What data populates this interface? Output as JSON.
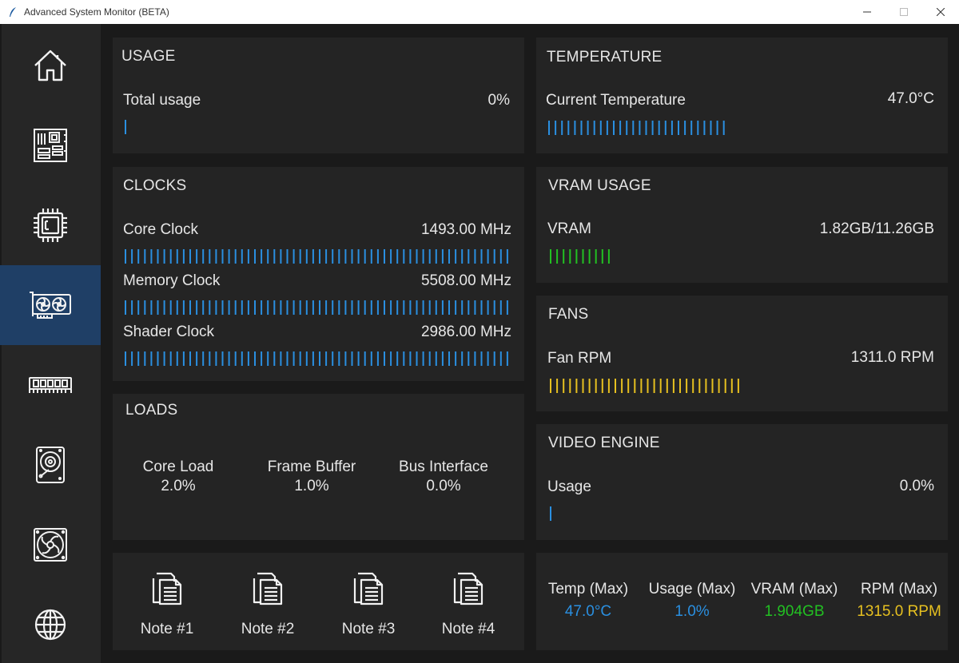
{
  "window": {
    "title": "Advanced System Monitor (BETA)",
    "minimize_icon": "minimize-icon",
    "maximize_icon": "maximize-icon",
    "close_icon": "close-icon"
  },
  "sidebar": {
    "items": [
      {
        "name": "home",
        "icon": "home-icon",
        "active": false
      },
      {
        "name": "motherboard",
        "icon": "motherboard-icon",
        "active": false
      },
      {
        "name": "cpu",
        "icon": "cpu-icon",
        "active": false
      },
      {
        "name": "gpu",
        "icon": "gpu-icon",
        "active": true
      },
      {
        "name": "ram",
        "icon": "ram-icon",
        "active": false
      },
      {
        "name": "storage",
        "icon": "hard-drive-icon",
        "active": false
      },
      {
        "name": "fans",
        "icon": "fan-icon",
        "active": false
      },
      {
        "name": "network",
        "icon": "globe-icon",
        "active": false
      }
    ],
    "active_color": "#1f3f66"
  },
  "usage": {
    "title": "USAGE",
    "label": "Total usage",
    "value": "0%",
    "level": 0.0
  },
  "clocks": {
    "title": "CLOCKS",
    "rows": [
      {
        "label": "Core Clock",
        "value": "1493.00 MHz",
        "level": 1.0
      },
      {
        "label": "Memory Clock",
        "value": "5508.00 MHz",
        "level": 1.0
      },
      {
        "label": "Shader Clock",
        "value": "2986.00 MHz",
        "level": 1.0
      }
    ]
  },
  "loads": {
    "title": "LOADS",
    "items": [
      {
        "label": "Core Load",
        "value": "2.0%"
      },
      {
        "label": "Frame Buffer",
        "value": "1.0%"
      },
      {
        "label": "Bus Interface",
        "value": "0.0%"
      }
    ]
  },
  "notes": {
    "items": [
      {
        "label": "Note #1",
        "icon": "notes-icon"
      },
      {
        "label": "Note #2",
        "icon": "notes-icon"
      },
      {
        "label": "Note #3",
        "icon": "notes-icon"
      },
      {
        "label": "Note #4",
        "icon": "notes-icon"
      }
    ]
  },
  "temperature": {
    "title": "TEMPERATURE",
    "label": "Current Temperature",
    "value": "47.0°C",
    "level": 0.47
  },
  "vram": {
    "title": "VRAM USAGE",
    "label": "VRAM",
    "value": "1.82GB/11.26GB",
    "level": 0.16
  },
  "fans": {
    "title": "FANS",
    "label": "Fan RPM",
    "value": "1311.0 RPM",
    "level": 0.5
  },
  "video_engine": {
    "title": "VIDEO ENGINE",
    "label": "Usage",
    "value": "0.0%",
    "level": 0.0
  },
  "max_stats": {
    "items": [
      {
        "label": "Temp (Max)",
        "value": "47.0°C",
        "color": "#2a8fe0"
      },
      {
        "label": "Usage (Max)",
        "value": "1.0%",
        "color": "#2a8fe0"
      },
      {
        "label": "VRAM (Max)",
        "value": "1.904GB",
        "color": "#22c022"
      },
      {
        "label": "RPM (Max)",
        "value": "1315.0 RPM",
        "color": "#e6c020"
      }
    ]
  },
  "colors": {
    "blue": "#2a8fe0",
    "green": "#22c022",
    "yellow": "#e6c020",
    "panel": "#242424",
    "background": "#1a1a1a"
  }
}
